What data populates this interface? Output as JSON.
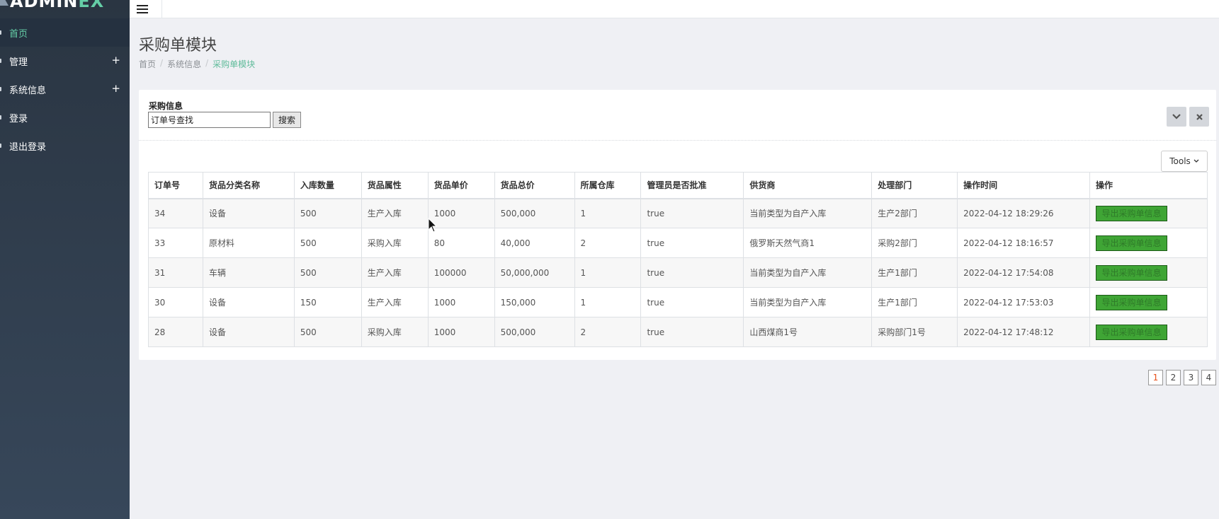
{
  "brand": {
    "prefix": "ADMIN",
    "accent": "EX"
  },
  "sidebar": {
    "items": [
      {
        "label": "首页",
        "active": true,
        "expandable": false
      },
      {
        "label": "管理",
        "active": false,
        "expandable": true
      },
      {
        "label": "系统信息",
        "active": false,
        "expandable": true
      },
      {
        "label": "登录",
        "active": false,
        "expandable": false
      },
      {
        "label": "退出登录",
        "active": false,
        "expandable": false
      }
    ],
    "expand_symbol": "+"
  },
  "page": {
    "title": "采购单模块",
    "breadcrumb": [
      "首页",
      "系统信息",
      "采购单模块"
    ]
  },
  "search": {
    "label": "采购信息",
    "value": "订单号查找",
    "button": "搜索"
  },
  "tools": {
    "label": "Tools"
  },
  "table": {
    "headers": [
      "订单号",
      "货品分类名称",
      "入库数量",
      "货品属性",
      "货品单价",
      "货品总价",
      "所属仓库",
      "管理员是否批准",
      "供货商",
      "处理部门",
      "操作时间",
      "操作"
    ],
    "action_label": "导出采购单信息",
    "rows": [
      [
        "34",
        "设备",
        "500",
        "生产入库",
        "1000",
        "500,000",
        "1",
        "true",
        "当前类型为自产入库",
        "生产2部门",
        "2022-04-12 18:29:26"
      ],
      [
        "33",
        "原材料",
        "500",
        "采购入库",
        "80",
        "40,000",
        "2",
        "true",
        "俄罗斯天然气商1",
        "采购2部门",
        "2022-04-12 18:16:57"
      ],
      [
        "31",
        "车辆",
        "500",
        "生产入库",
        "100000",
        "50,000,000",
        "1",
        "true",
        "当前类型为自产入库",
        "生产1部门",
        "2022-04-12 17:54:08"
      ],
      [
        "30",
        "设备",
        "150",
        "生产入库",
        "1000",
        "150,000",
        "1",
        "true",
        "当前类型为自产入库",
        "生产1部门",
        "2022-04-12 17:53:03"
      ],
      [
        "28",
        "设备",
        "500",
        "采购入库",
        "1000",
        "500,000",
        "2",
        "true",
        "山西煤商1号",
        "采购部门1号",
        "2022-04-12 17:48:12"
      ]
    ]
  },
  "pagination": {
    "pages": [
      "1",
      "2",
      "3",
      "4"
    ],
    "current": "1"
  },
  "colors": {
    "accent": "#65cea7",
    "sidebar": "#2a3542",
    "export_button": "#3fa535",
    "active_page": "#e8501a"
  }
}
